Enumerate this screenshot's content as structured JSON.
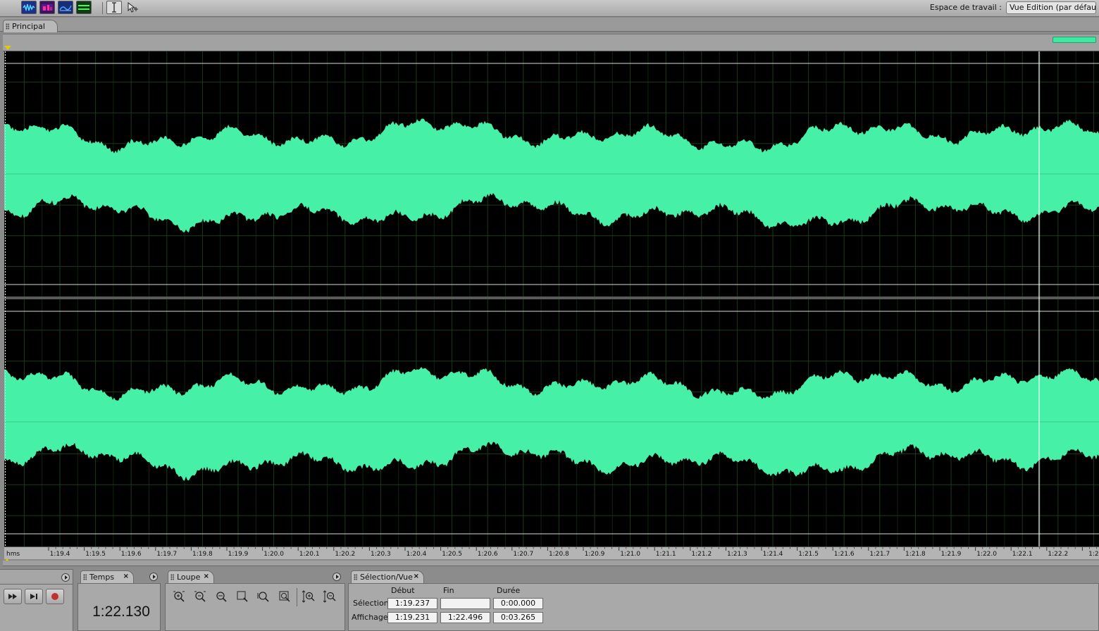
{
  "toolbar": {
    "tools": [
      {
        "name": "waveform-view-icon",
        "color": "#1d2f88",
        "accent": "#52d8ff"
      },
      {
        "name": "spectral-view-icon",
        "color": "#3a1460",
        "accent": "#ff2ea0"
      },
      {
        "name": "pan-view-icon",
        "color": "#162e7a",
        "accent": "#50a0ff"
      },
      {
        "name": "phase-view-icon",
        "color": "#0e3a14",
        "accent": "#3cff5a"
      }
    ],
    "selection_tool_icon": "i-beam-icon",
    "move_tool_icon": "arrow-move-icon",
    "workspace_label": "Espace de travail :",
    "workspace_value": "Vue Edition (par défaut)"
  },
  "main_tab": {
    "label": "Principal"
  },
  "waveform": {
    "color": "#46f0a6",
    "background": "#000000",
    "grid_color": "#1c3b1c",
    "cursor_time": "1:22.130",
    "channels": 2
  },
  "ruler": {
    "unit_label": "hms",
    "ticks": [
      "1:19.4",
      "1:19.5",
      "1:19.6",
      "1:19.7",
      "1:19.8",
      "1:19.9",
      "1:20.0",
      "1:20.1",
      "1:20.2",
      "1:20.3",
      "1:20.4",
      "1:20.5",
      "1:20.6",
      "1:20.7",
      "1:20.8",
      "1:20.9",
      "1:21.0",
      "1:21.1",
      "1:21.2",
      "1:21.3",
      "1:21.4",
      "1:21.5",
      "1:21.6",
      "1:21.7",
      "1:21.8",
      "1:21.9",
      "1:22.0",
      "1:22.1",
      "1:22.2",
      "1:2"
    ]
  },
  "transport": {
    "buttons": [
      "fast-forward-icon",
      "skip-to-end-icon",
      "record-icon"
    ]
  },
  "time_panel": {
    "tab_label": "Temps",
    "close": "×",
    "value": "1:22.130"
  },
  "zoom_panel": {
    "tab_label": "Loupe",
    "close": "×",
    "buttons": [
      "zoom-in-horizontal-icon",
      "zoom-out-horizontal-icon",
      "zoom-out-full-icon",
      "zoom-to-selection-icon",
      "zoom-left-edge-icon",
      "zoom-right-edge-icon",
      "zoom-in-vertical-icon",
      "zoom-out-vertical-icon"
    ]
  },
  "selection_panel": {
    "tab_label": "Sélection/Vue",
    "close": "×",
    "headers": {
      "start": "Début",
      "end": "Fin",
      "duration": "Durée"
    },
    "rows": [
      {
        "label": "Sélection",
        "start": "1:19.237",
        "end": "",
        "duration": "0:00.000"
      },
      {
        "label": "Affichage",
        "start": "1:19.231",
        "end": "1:22.496",
        "duration": "0:03.265"
      }
    ]
  }
}
